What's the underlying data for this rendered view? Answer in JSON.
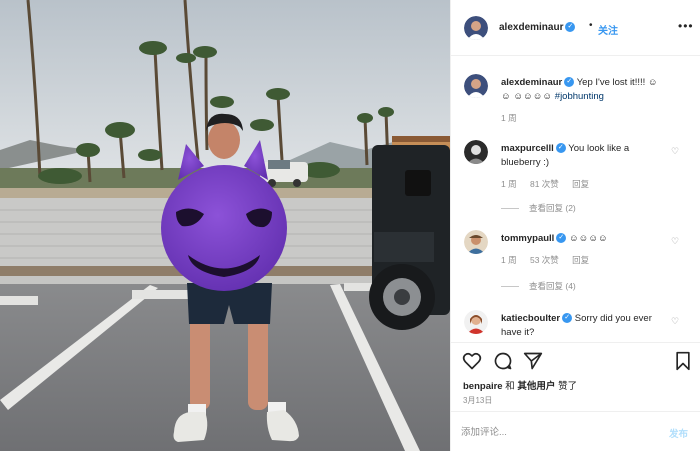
{
  "post": {
    "author": "alexdeminaur",
    "verified_mark": "✓",
    "follow_separator": "•",
    "follow_label": "关注",
    "more_icon": "more-horizontal-icon"
  },
  "caption": {
    "username": "alexdeminaur",
    "text": "Yep I've lost it!!!! ☺☺ ☺☺☺☺ ",
    "hashtag": "#jobhunting",
    "age": "1 周"
  },
  "comments": [
    {
      "username": "maxpurcelll",
      "text": "You look like a blueberry :)",
      "age": "1 周",
      "likes": "81 次赞",
      "reply_label": "回复",
      "view_replies": "查看回复 (2)"
    },
    {
      "username": "tommypaull",
      "text": "☺☺☺☺",
      "age": "1 周",
      "likes": "53 次赞",
      "reply_label": "回复",
      "view_replies": "查看回复 (4)"
    },
    {
      "username": "katiecboulter",
      "text": "Sorry did you ever have it?"
    }
  ],
  "actions": {
    "like_icon": "heart-icon",
    "comment_icon": "comment-icon",
    "share_icon": "share-icon",
    "save_icon": "bookmark-icon",
    "liked_by_user": "benpaire",
    "liked_by_joiner": "和",
    "liked_by_others": "其他用户",
    "liked_suffix": "赞了",
    "date": "3月13日"
  },
  "composer": {
    "placeholder": "添加评论...",
    "post_label": "发布"
  },
  "colors": {
    "accent": "#3897f0",
    "costume": "#7a3fc6",
    "post_disabled": "#b2dffc"
  }
}
